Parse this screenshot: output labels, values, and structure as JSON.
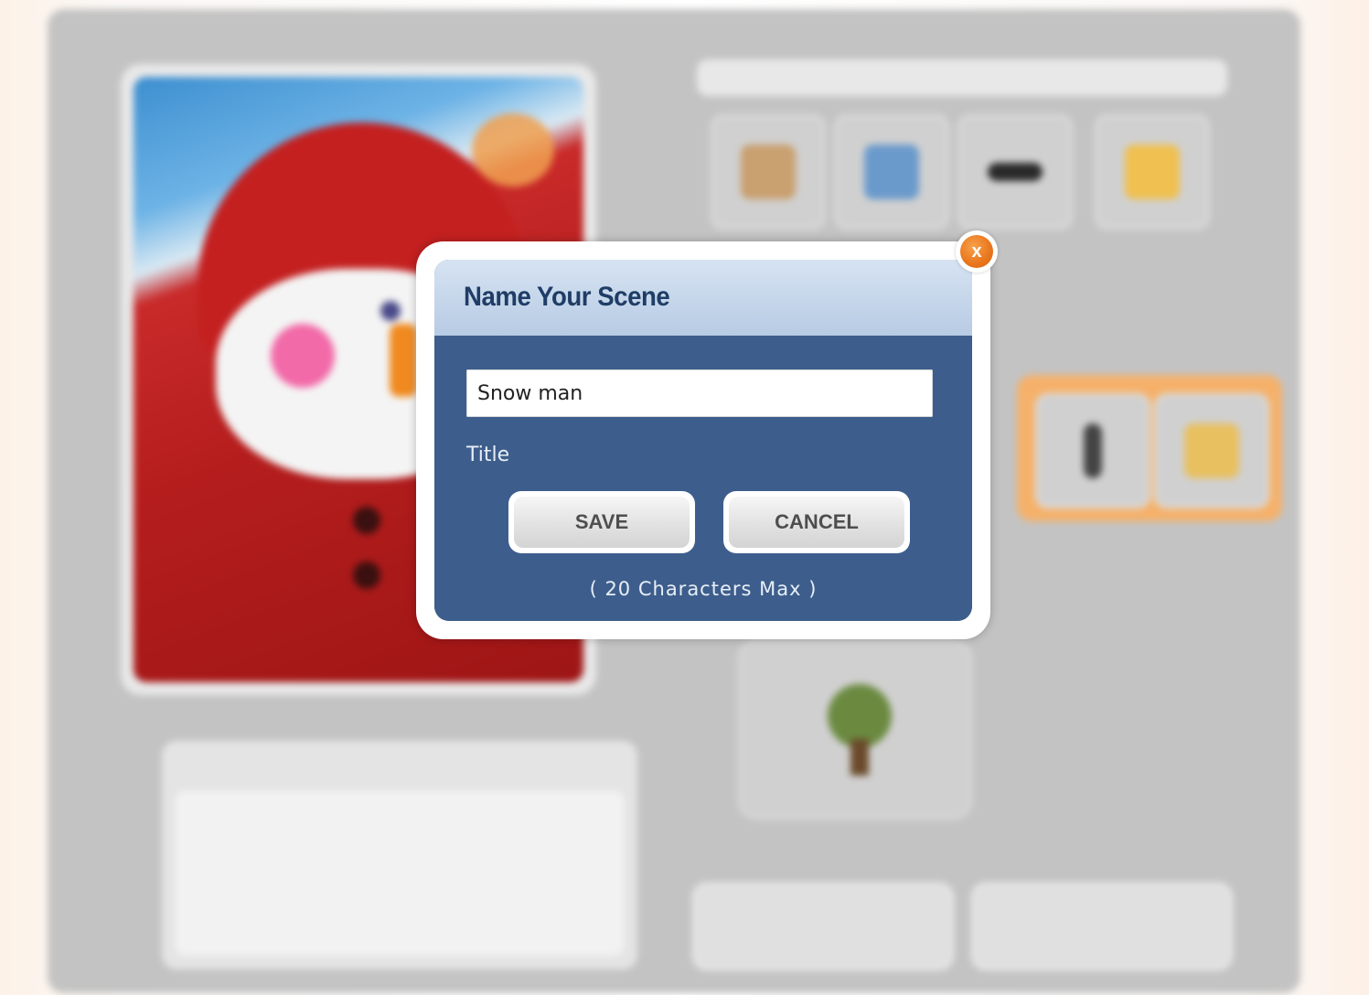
{
  "dialog": {
    "title": "Name Your Scene",
    "input_value": "Snow man",
    "input_label": "Title",
    "save_label": "SAVE",
    "cancel_label": "CANCEL",
    "max_note": "( 20 Characters Max )",
    "close_label": "x"
  },
  "colors": {
    "dialog_body": "#3d5e8c",
    "dialog_header": "#b7cbe4",
    "close_button": "#e9751c"
  },
  "background_tiles": [
    "character-icon",
    "clothing-icon",
    "glasses-icon",
    "folder-icon",
    "pencil-icon",
    "folder-icon",
    "tree-icon"
  ]
}
